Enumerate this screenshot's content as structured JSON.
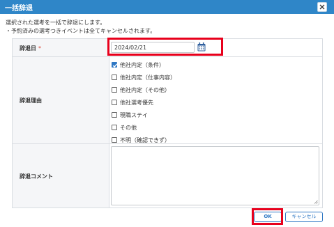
{
  "dialog": {
    "title": "一括辞退",
    "close_icon": "close-icon",
    "title_bar_color": "#2f86c8"
  },
  "info": {
    "line1": "選択された選考を一括で辞退にします。",
    "line2": "・予約済みの選考つきイベントは全てキャンセルされます。"
  },
  "form": {
    "date": {
      "label": "辞退日",
      "required_mark": "*",
      "value": "2024/02/21",
      "icon": "calendar-icon"
    },
    "reason": {
      "label": "辞退理由",
      "options": [
        {
          "label": "他社内定（条件）",
          "checked": true
        },
        {
          "label": "他社内定（仕事内容）",
          "checked": false
        },
        {
          "label": "他社内定（その他）",
          "checked": false
        },
        {
          "label": "他社選考優先",
          "checked": false
        },
        {
          "label": "現職ステイ",
          "checked": false
        },
        {
          "label": "その他",
          "checked": false
        },
        {
          "label": "不明（確認できず）",
          "checked": false
        }
      ]
    },
    "comment": {
      "label": "辞退コメント",
      "value": ""
    }
  },
  "buttons": {
    "ok": "OK",
    "cancel": "キャンセル"
  },
  "colors": {
    "accent": "#2f78c4",
    "highlight": "#e8001c",
    "required": "#d84a3a"
  }
}
